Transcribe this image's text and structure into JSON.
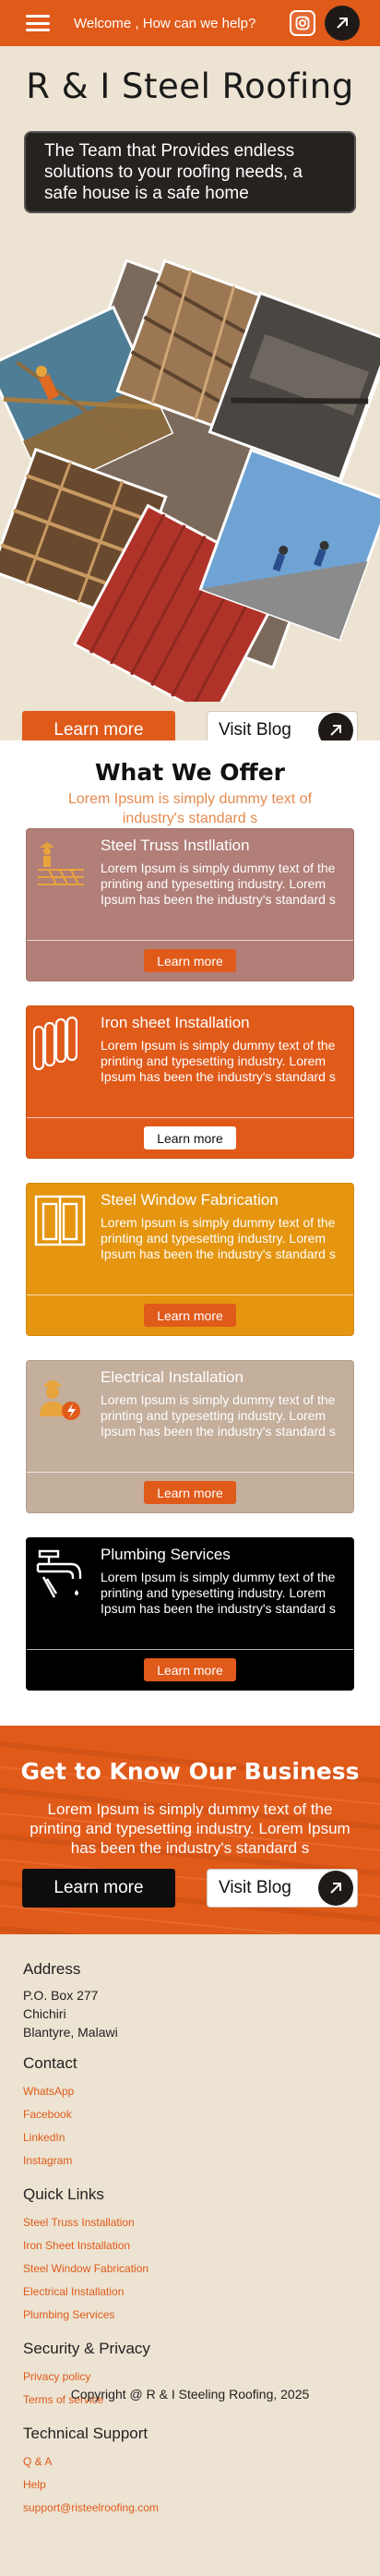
{
  "header": {
    "welcome": "Welcome , How can we help?"
  },
  "hero": {
    "title": "R & I Steel Roofing",
    "tagline": "The Team that Provides endless solutions to your roofing needs, a safe house is a safe home",
    "learn_more": "Learn more",
    "visit_blog": "Visit Blog"
  },
  "offers": {
    "title": "What We Offer",
    "subtitle": "Lorem Ipsum is simply dummy text of industry's standard s",
    "items": [
      {
        "title": "Steel Truss Instllation",
        "text": "Lorem Ipsum is simply dummy text of the printing and typesetting industry. Lorem Ipsum has been the industry's standard s",
        "button": "Learn more",
        "icon": "truss-icon",
        "color": "#b17e78"
      },
      {
        "title": "Iron sheet Installation",
        "text": "Lorem Ipsum is simply dummy text of the printing and typesetting industry. Lorem Ipsum has been the industry's standard s",
        "button": "Learn more",
        "icon": "iron-sheet-icon",
        "color": "#e05a1a"
      },
      {
        "title": "Steel Window Fabrication",
        "text": "Lorem Ipsum is simply dummy text of the printing and typesetting industry. Lorem Ipsum has been the industry's standard s",
        "button": "Learn more",
        "icon": "window-icon",
        "color": "#e5950f"
      },
      {
        "title": "Electrical Installation",
        "text": "Lorem Ipsum is simply dummy text of the printing and typesetting industry. Lorem Ipsum has been the industry's standard s",
        "button": "Learn more",
        "icon": "electrician-icon",
        "color": "#c4ae9c"
      },
      {
        "title": "Plumbing Services",
        "text": "Lorem Ipsum is simply dummy text of the printing and typesetting industry. Lorem Ipsum has been the industry's standard s",
        "button": "Learn more",
        "icon": "faucet-icon",
        "color": "#000000"
      }
    ]
  },
  "business": {
    "title": "Get to Know Our Business",
    "text": "Lorem Ipsum is simply dummy text of the printing and typesetting industry. Lorem Ipsum has been the industry's standard s",
    "learn_more": "Learn more",
    "visit_blog": "Visit Blog"
  },
  "footer": {
    "address": {
      "title": "Address",
      "lines": [
        "P.O. Box 277",
        "Chichiri",
        "Blantyre, Malawi"
      ]
    },
    "contact": {
      "title": "Contact",
      "links": [
        "WhatsApp",
        "Facebook",
        "LinkedIn",
        "Instagram"
      ]
    },
    "quick_links": {
      "title": "Quick Links",
      "links": [
        "Steel Truss Installation",
        "Iron Sheet Installation",
        "Steel Window Fabrication",
        "Electrical Installation",
        "Plumbing Services"
      ]
    },
    "security": {
      "title": "Security & Privacy",
      "links": [
        "Privacy policy",
        "Terms of service"
      ]
    },
    "support": {
      "title": "Technical Support",
      "links": [
        "Q & A",
        "Help",
        "support@risteelroofing.com"
      ]
    },
    "copyright": "Copyright @ R & I Steeling Roofing, 2025"
  },
  "colors": {
    "brand_orange": "#e05a1a",
    "cream": "#ece3d2",
    "dark": "#1f1a17"
  }
}
